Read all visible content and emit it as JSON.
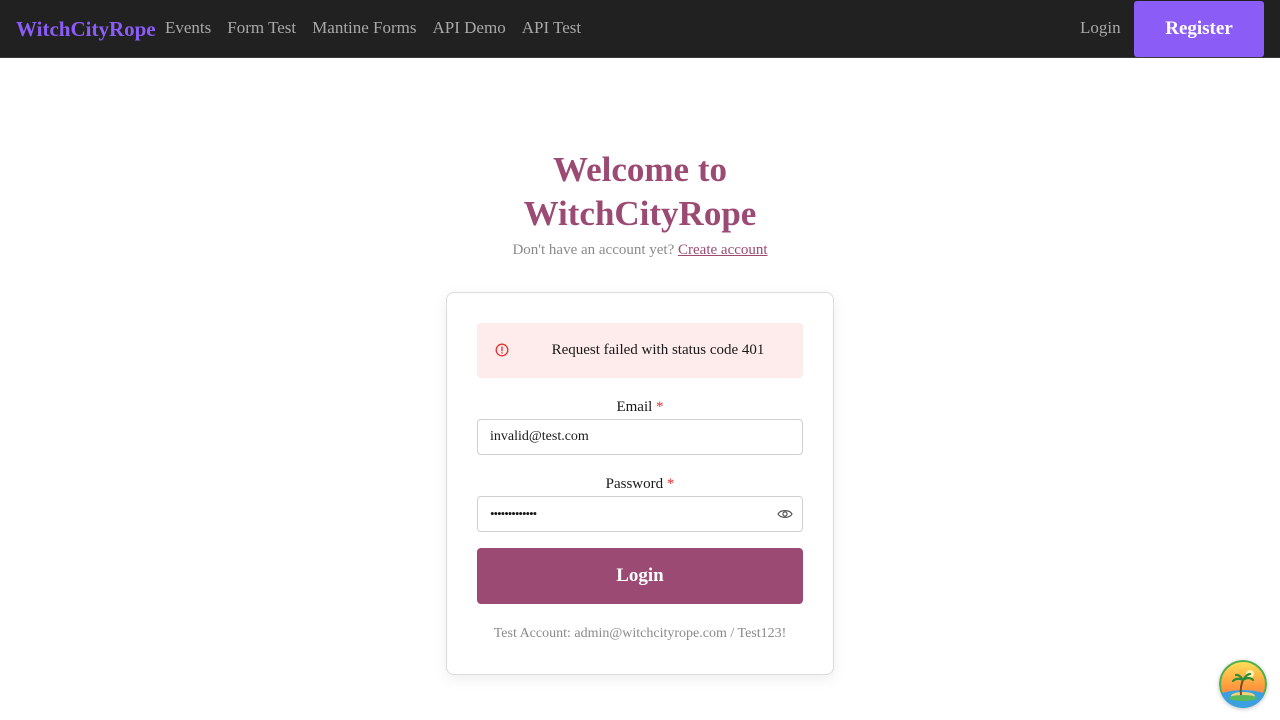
{
  "nav": {
    "brand": "WitchCityRope",
    "links": [
      "Events",
      "Form Test",
      "Mantine Forms",
      "API Demo",
      "API Test"
    ],
    "login_label": "Login",
    "register_label": "Register"
  },
  "header": {
    "title_line1": "Welcome to",
    "title_line2": "WitchCityRope",
    "subtitle_prefix": "Don't have an account yet?",
    "create_account_label": "Create account"
  },
  "form": {
    "error_icon": "alert-circle-icon",
    "error_message": "Request failed with status code 401",
    "email_label": "Email",
    "email_value": "invalid@test.com",
    "password_label": "Password",
    "password_masked": "•••••••••••••",
    "required_mark": "*",
    "submit_label": "Login",
    "test_account_text": "Test Account: admin@witchcityrope.com / Test123!"
  },
  "colors": {
    "brand_purple": "#8b5cf6",
    "accent_plum": "#9b4a73",
    "navbar_bg": "#212121",
    "error_bg": "#fdeceb",
    "error_icon": "#e03131"
  },
  "fab_icon": "island-sunset-icon"
}
